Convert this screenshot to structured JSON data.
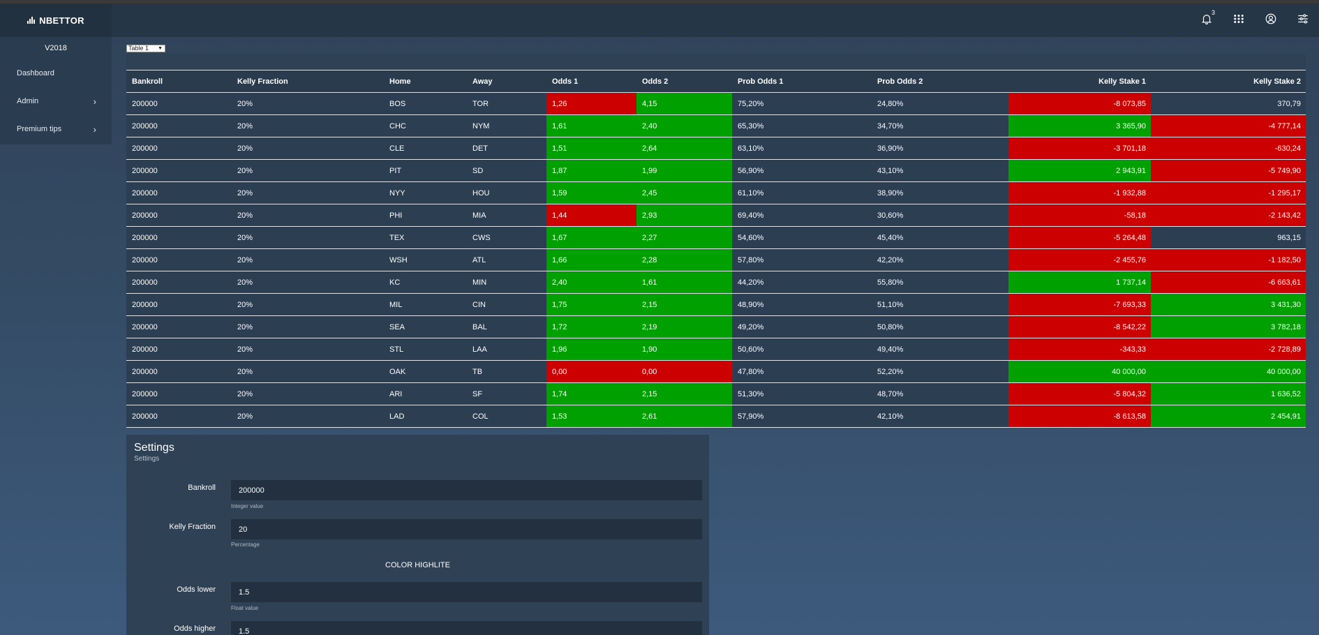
{
  "app": {
    "brand": "NBETTOR",
    "version": "V2018",
    "notification_count": "3"
  },
  "topbar": {
    "icons": [
      "bell-icon",
      "apps-grid-icon",
      "user-circle-icon",
      "sliders-icon"
    ]
  },
  "sidebar": {
    "items": [
      {
        "label": "Dashboard",
        "has_children": false
      },
      {
        "label": "Admin",
        "has_children": true
      },
      {
        "label": "Premium tips",
        "has_children": true
      }
    ]
  },
  "table_selector": {
    "value": "Table 1"
  },
  "table": {
    "headers": [
      "Bankroll",
      "Kelly Fraction",
      "Home",
      "Away",
      "Odds 1",
      "Odds 2",
      "Prob Odds 1",
      "Prob Odds 2",
      "Kelly Stake 1",
      "Kelly Stake 2"
    ],
    "rows": [
      {
        "bankroll": "200000",
        "kelly_fraction": "20%",
        "home": "BOS",
        "away": "TOR",
        "odds1": "1,26",
        "odds1_color": "red",
        "odds2": "4,15",
        "odds2_color": "green",
        "prob1": "75,20%",
        "prob2": "24,80%",
        "stake1": "-8 073,85",
        "stake1_color": "red",
        "stake2": "370,79",
        "stake2_color": "none"
      },
      {
        "bankroll": "200000",
        "kelly_fraction": "20%",
        "home": "CHC",
        "away": "NYM",
        "odds1": "1,61",
        "odds1_color": "green",
        "odds2": "2,40",
        "odds2_color": "green",
        "prob1": "65,30%",
        "prob2": "34,70%",
        "stake1": "3 365,90",
        "stake1_color": "green",
        "stake2": "-4 777,14",
        "stake2_color": "red"
      },
      {
        "bankroll": "200000",
        "kelly_fraction": "20%",
        "home": "CLE",
        "away": "DET",
        "odds1": "1,51",
        "odds1_color": "green",
        "odds2": "2,64",
        "odds2_color": "green",
        "prob1": "63,10%",
        "prob2": "36,90%",
        "stake1": "-3 701,18",
        "stake1_color": "red",
        "stake2": "-630,24",
        "stake2_color": "red"
      },
      {
        "bankroll": "200000",
        "kelly_fraction": "20%",
        "home": "PIT",
        "away": "SD",
        "odds1": "1,87",
        "odds1_color": "green",
        "odds2": "1,99",
        "odds2_color": "green",
        "prob1": "56,90%",
        "prob2": "43,10%",
        "stake1": "2 943,91",
        "stake1_color": "green",
        "stake2": "-5 749,90",
        "stake2_color": "red"
      },
      {
        "bankroll": "200000",
        "kelly_fraction": "20%",
        "home": "NYY",
        "away": "HOU",
        "odds1": "1,59",
        "odds1_color": "green",
        "odds2": "2,45",
        "odds2_color": "green",
        "prob1": "61,10%",
        "prob2": "38,90%",
        "stake1": "-1 932,88",
        "stake1_color": "red",
        "stake2": "-1 295,17",
        "stake2_color": "red"
      },
      {
        "bankroll": "200000",
        "kelly_fraction": "20%",
        "home": "PHI",
        "away": "MIA",
        "odds1": "1,44",
        "odds1_color": "red",
        "odds2": "2,93",
        "odds2_color": "green",
        "prob1": "69,40%",
        "prob2": "30,60%",
        "stake1": "-58,18",
        "stake1_color": "red",
        "stake2": "-2 143,42",
        "stake2_color": "red"
      },
      {
        "bankroll": "200000",
        "kelly_fraction": "20%",
        "home": "TEX",
        "away": "CWS",
        "odds1": "1,67",
        "odds1_color": "green",
        "odds2": "2,27",
        "odds2_color": "green",
        "prob1": "54,60%",
        "prob2": "45,40%",
        "stake1": "-5 264,48",
        "stake1_color": "red",
        "stake2": "963,15",
        "stake2_color": "none"
      },
      {
        "bankroll": "200000",
        "kelly_fraction": "20%",
        "home": "WSH",
        "away": "ATL",
        "odds1": "1,66",
        "odds1_color": "green",
        "odds2": "2,28",
        "odds2_color": "green",
        "prob1": "57,80%",
        "prob2": "42,20%",
        "stake1": "-2 455,76",
        "stake1_color": "red",
        "stake2": "-1 182,50",
        "stake2_color": "red"
      },
      {
        "bankroll": "200000",
        "kelly_fraction": "20%",
        "home": "KC",
        "away": "MIN",
        "odds1": "2,40",
        "odds1_color": "green",
        "odds2": "1,61",
        "odds2_color": "green",
        "prob1": "44,20%",
        "prob2": "55,80%",
        "stake1": "1 737,14",
        "stake1_color": "green",
        "stake2": "-6 663,61",
        "stake2_color": "red"
      },
      {
        "bankroll": "200000",
        "kelly_fraction": "20%",
        "home": "MIL",
        "away": "CIN",
        "odds1": "1,75",
        "odds1_color": "green",
        "odds2": "2,15",
        "odds2_color": "green",
        "prob1": "48,90%",
        "prob2": "51,10%",
        "stake1": "-7 693,33",
        "stake1_color": "red",
        "stake2": "3 431,30",
        "stake2_color": "green"
      },
      {
        "bankroll": "200000",
        "kelly_fraction": "20%",
        "home": "SEA",
        "away": "BAL",
        "odds1": "1,72",
        "odds1_color": "green",
        "odds2": "2,19",
        "odds2_color": "green",
        "prob1": "49,20%",
        "prob2": "50,80%",
        "stake1": "-8 542,22",
        "stake1_color": "red",
        "stake2": "3 782,18",
        "stake2_color": "green"
      },
      {
        "bankroll": "200000",
        "kelly_fraction": "20%",
        "home": "STL",
        "away": "LAA",
        "odds1": "1,96",
        "odds1_color": "green",
        "odds2": "1,90",
        "odds2_color": "green",
        "prob1": "50,60%",
        "prob2": "49,40%",
        "stake1": "-343,33",
        "stake1_color": "red",
        "stake2": "-2 728,89",
        "stake2_color": "red"
      },
      {
        "bankroll": "200000",
        "kelly_fraction": "20%",
        "home": "OAK",
        "away": "TB",
        "odds1": "0,00",
        "odds1_color": "red",
        "odds2": "0,00",
        "odds2_color": "red",
        "prob1": "47,80%",
        "prob2": "52,20%",
        "stake1": "40 000,00",
        "stake1_color": "green",
        "stake2": "40 000,00",
        "stake2_color": "green"
      },
      {
        "bankroll": "200000",
        "kelly_fraction": "20%",
        "home": "ARI",
        "away": "SF",
        "odds1": "1,74",
        "odds1_color": "green",
        "odds2": "2,15",
        "odds2_color": "green",
        "prob1": "51,30%",
        "prob2": "48,70%",
        "stake1": "-5 804,32",
        "stake1_color": "red",
        "stake2": "1 636,52",
        "stake2_color": "green"
      },
      {
        "bankroll": "200000",
        "kelly_fraction": "20%",
        "home": "LAD",
        "away": "COL",
        "odds1": "1,53",
        "odds1_color": "green",
        "odds2": "2,61",
        "odds2_color": "green",
        "prob1": "57,90%",
        "prob2": "42,10%",
        "stake1": "-8 613,58",
        "stake1_color": "red",
        "stake2": "2 454,91",
        "stake2_color": "green"
      }
    ]
  },
  "settings": {
    "title": "Settings",
    "subtitle": "Settings",
    "bankroll": {
      "label": "Bankroll",
      "value": "200000",
      "help": "Integer value"
    },
    "kelly_fraction": {
      "label": "Kelly Fraction",
      "value": "20",
      "help": "Percentage"
    },
    "color_section": "COLOR HIGHLITE",
    "odds_lower": {
      "label": "Odds lower",
      "value": "1.5",
      "help": "Float value"
    },
    "odds_higher": {
      "label": "Odds higher",
      "value": "1.5"
    }
  },
  "colors": {
    "red": "#cc0000",
    "green": "#00a000",
    "row_bg": "#2c3e52"
  }
}
